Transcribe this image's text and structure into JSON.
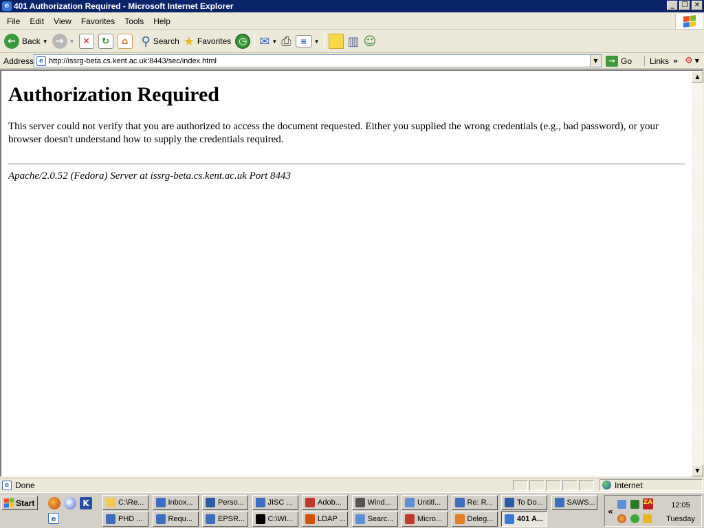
{
  "window": {
    "title": "401 Authorization Required - Microsoft Internet Explorer",
    "controls": [
      "_",
      "❐",
      "✕"
    ]
  },
  "menu": [
    "File",
    "Edit",
    "View",
    "Favorites",
    "Tools",
    "Help"
  ],
  "toolbar": {
    "back_label": "Back",
    "search_label": "Search",
    "favorites_label": "Favorites"
  },
  "address": {
    "label": "Address",
    "url": "http://issrg-beta.cs.kent.ac.uk:8443/sec/index.html",
    "go_label": "Go",
    "links_label": "Links",
    "chevron": "»"
  },
  "page": {
    "heading": "Authorization Required",
    "body": "This server could not verify that you are authorized to access the document requested. Either you supplied the wrong credentials (e.g., bad password), or your browser doesn't understand how to supply the credentials required.",
    "server_signature": "Apache/2.0.52 (Fedora) Server at issrg-beta.cs.kent.ac.uk Port 8443"
  },
  "status": {
    "text": "Done",
    "zone": "Internet"
  },
  "taskbar": {
    "start_label": "Start",
    "row1": [
      {
        "label": "C:\\Re...",
        "icon": "folder-icon",
        "color": "#f2c94c"
      },
      {
        "label": "Inbox...",
        "icon": "mail-client-icon",
        "color": "#3c6fc4"
      },
      {
        "label": "Perso...",
        "icon": "word-doc-icon",
        "color": "#2b5aa8"
      },
      {
        "label": "JISC ...",
        "icon": "mail-client-icon",
        "color": "#3c6fc4"
      },
      {
        "label": "Adob...",
        "icon": "acrobat-icon",
        "color": "#c0392b"
      },
      {
        "label": "Wind...",
        "icon": "console-window-icon",
        "color": "#555555"
      },
      {
        "label": "Untitl...",
        "icon": "document-icon",
        "color": "#5b8fd6"
      },
      {
        "label": "Re: R...",
        "icon": "mail-client-icon",
        "color": "#3c6fc4"
      },
      {
        "label": "To Do...",
        "icon": "word-doc-icon",
        "color": "#2b5aa8"
      },
      {
        "label": "SAWS...",
        "icon": "mail-client-icon",
        "color": "#3c6fc4"
      }
    ],
    "row2": [
      {
        "label": "PHD ...",
        "icon": "mail-client-icon",
        "color": "#3c6fc4"
      },
      {
        "label": "Requ...",
        "icon": "mail-client-icon",
        "color": "#3c6fc4"
      },
      {
        "label": "EPSR...",
        "icon": "mail-client-icon",
        "color": "#3c6fc4"
      },
      {
        "label": "C:\\WI...",
        "icon": "command-prompt-icon",
        "color": "#000000"
      },
      {
        "label": "LDAP ...",
        "icon": "java-icon",
        "color": "#d35400"
      },
      {
        "label": "Searc...",
        "icon": "search-doc-icon",
        "color": "#5b8fd6"
      },
      {
        "label": "Micro...",
        "icon": "powerpoint-icon",
        "color": "#c0392b"
      },
      {
        "label": "Deleg...",
        "icon": "firefox-icon",
        "color": "#e67e22"
      },
      {
        "label": "401 A...",
        "icon": "ie-icon",
        "color": "#3a78d6"
      }
    ],
    "clock": "12:05",
    "day": "Tuesday",
    "tray_chevron": "«",
    "zonealarm_label": "ZA"
  }
}
